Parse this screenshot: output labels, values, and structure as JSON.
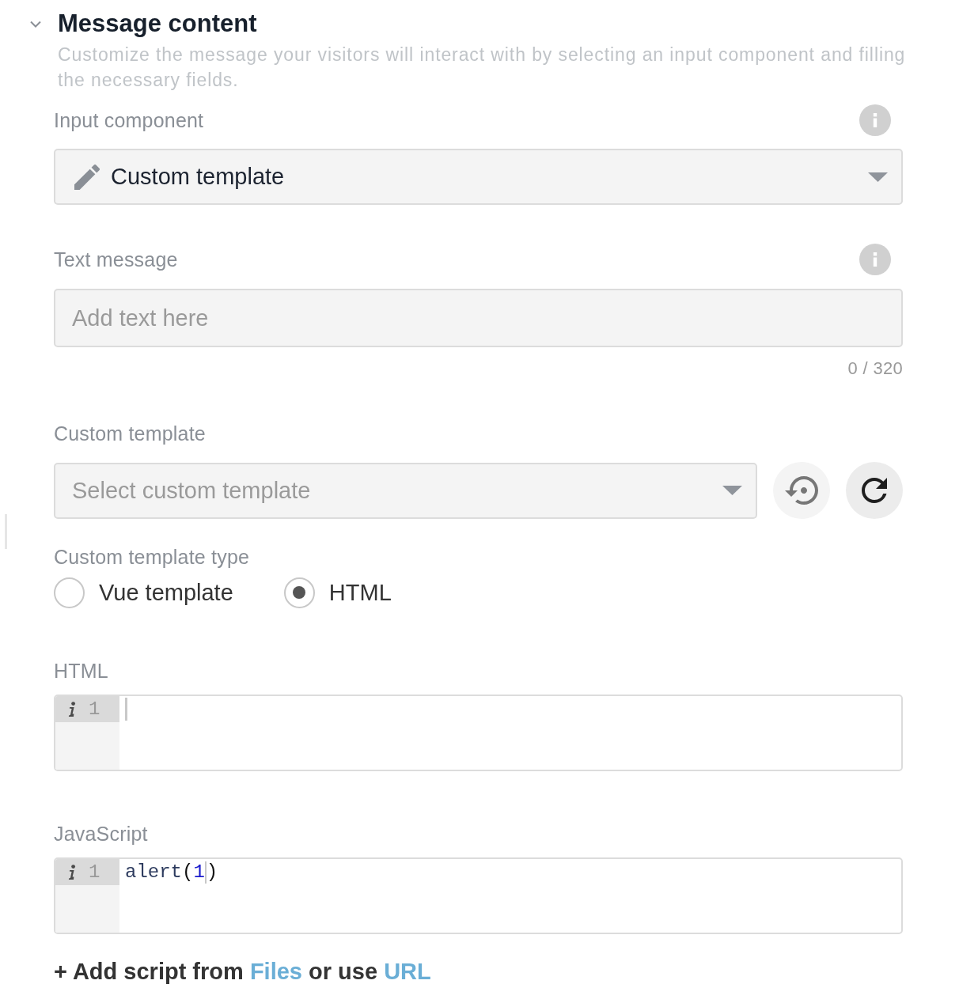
{
  "section": {
    "title": "Message content",
    "expanded": true,
    "description": "Customize the message your visitors will interact with by selecting an input component and filling the necessary fields."
  },
  "input_component": {
    "label": "Input component",
    "info": true,
    "value": "Custom template"
  },
  "text_message": {
    "label": "Text message",
    "info": true,
    "placeholder": "Add text here",
    "counter": "0 / 320"
  },
  "custom_template": {
    "label": "Custom template",
    "placeholder": "Select custom template"
  },
  "custom_template_type": {
    "label": "Custom template type",
    "options": [
      {
        "label": "Vue template",
        "selected": false
      },
      {
        "label": "HTML",
        "selected": true
      }
    ]
  },
  "editors": [
    {
      "label": "HTML",
      "lines": [
        {
          "number": "1",
          "active": true,
          "tokens": [
            {
              "kind": "cursor"
            }
          ]
        }
      ]
    },
    {
      "label": "JavaScript",
      "lines": [
        {
          "number": "1",
          "active": true,
          "tokens": [
            {
              "kind": "identifier",
              "text": "alert"
            },
            {
              "kind": "bracket",
              "text": "("
            },
            {
              "kind": "number",
              "text": "1"
            },
            {
              "kind": "cursor"
            },
            {
              "kind": "bracket",
              "text": ")"
            }
          ]
        }
      ]
    }
  ],
  "add_script": {
    "parts": [
      {
        "kind": "text",
        "text": "+ Add script from"
      },
      {
        "kind": "link",
        "text": "Files"
      },
      {
        "kind": "text",
        "text": "or use"
      },
      {
        "kind": "link",
        "text": "URL"
      }
    ]
  }
}
